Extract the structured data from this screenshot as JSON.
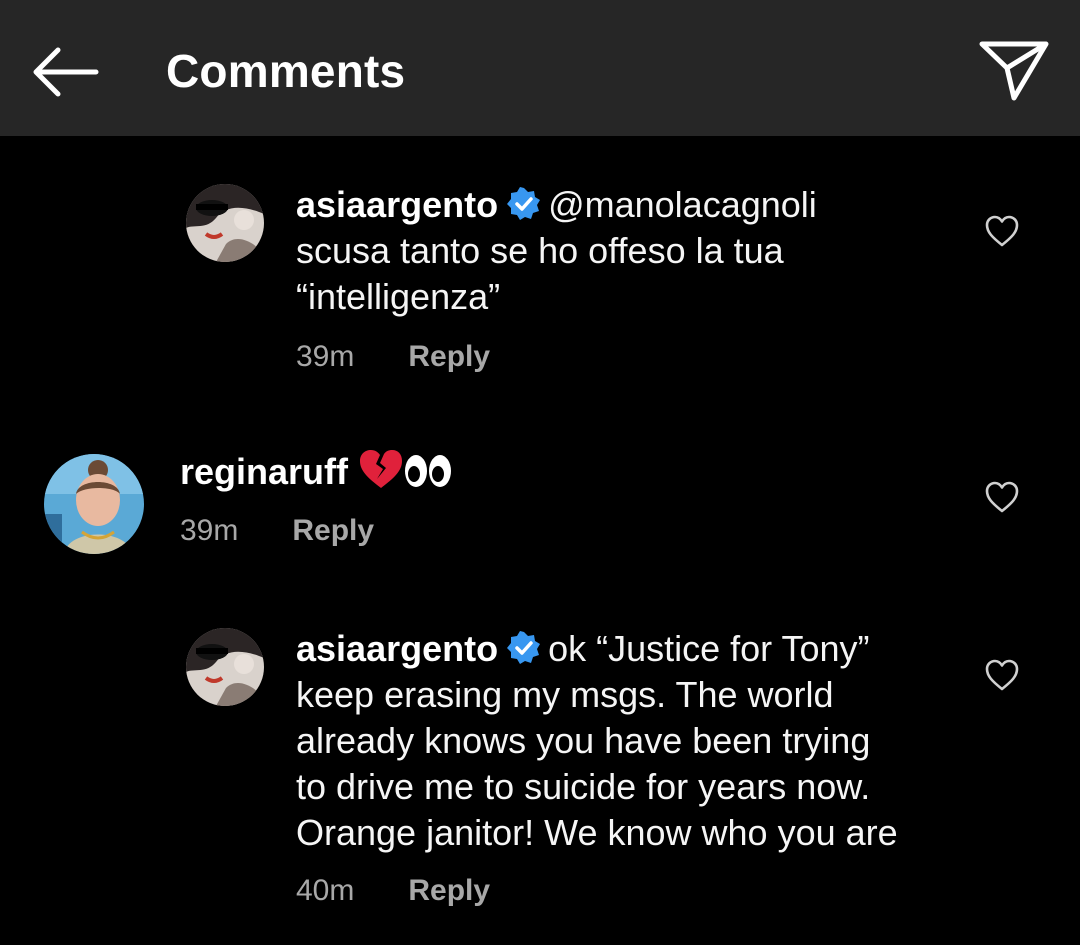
{
  "header": {
    "title": "Comments",
    "back_icon": "arrow-left-icon",
    "send_icon": "paper-plane-icon"
  },
  "comments": [
    {
      "username": "asiaargento",
      "verified": true,
      "mention": "@manolacagnoli",
      "line1_rest": "",
      "lines": [
        "scusa tanto se ho offeso la tua",
        "“intelligenza”"
      ],
      "time": "39m",
      "reply_label": "Reply"
    },
    {
      "username": "reginaruff",
      "verified": false,
      "emojis": [
        "broken-heart-emoji",
        "eyes-emoji"
      ],
      "time": "39m",
      "reply_label": "Reply"
    },
    {
      "username": "asiaargento",
      "verified": true,
      "line1_rest": "ok “Justice for Tony”",
      "lines": [
        "keep erasing my msgs. The world",
        "already knows you have been trying",
        "to drive me to suicide for years now.",
        "Orange janitor! We know who you are"
      ],
      "time": "40m",
      "reply_label": "Reply"
    }
  ],
  "colors": {
    "background": "#000000",
    "header_bg": "#262626",
    "meta_text": "#a8a8a8",
    "verified_blue": "#3897f0"
  }
}
